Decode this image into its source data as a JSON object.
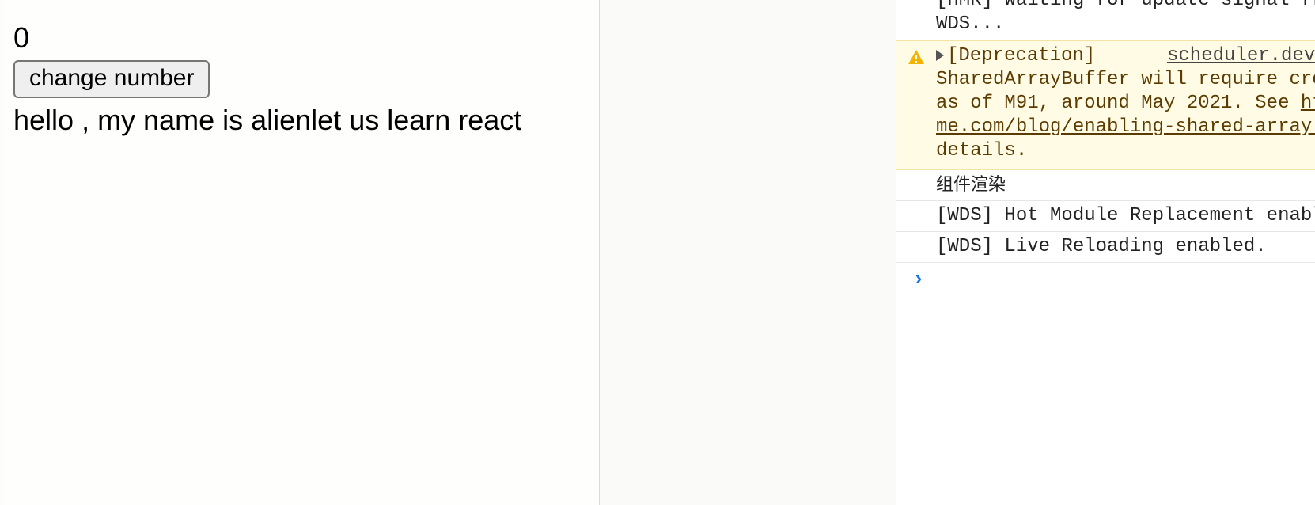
{
  "app": {
    "counter_value": "0",
    "button_label": "change number",
    "greeting_text": "hello , my name is alienlet us learn react"
  },
  "console": {
    "log_top": {
      "line1": "[HMR] Waiting for update signal from",
      "line2": "WDS..."
    },
    "warning": {
      "label": "[Deprecation]",
      "source": "scheduler.dev",
      "line2": "SharedArrayBuffer will require cro",
      "line3_prefix": "as of M91, around May 2021. See ",
      "line3_link": "ht",
      "line4_link": "me.com/blog/enabling-shared-array-",
      "line5": "details."
    },
    "logs": [
      "组件渲染",
      "[WDS] Hot Module Replacement enabl",
      "[WDS] Live Reloading enabled."
    ],
    "prompt_symbol": "›"
  },
  "colors": {
    "warning_bg": "#fffbe5",
    "warning_icon": "#f2b400",
    "prompt": "#1a73e8"
  },
  "icons": {
    "warning": "warning-icon",
    "expand": "expand-arrow-icon",
    "prompt": "console-prompt-icon"
  }
}
